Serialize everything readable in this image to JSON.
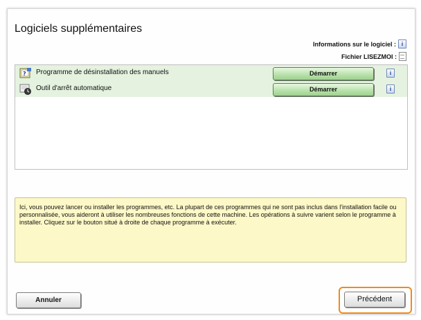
{
  "window": {
    "title": "Logiciels supplémentaires",
    "info_software_label": "Informations sur le logiciel :",
    "readme_label": "Fichier LISEZMOI :",
    "info_icon_glyph": "i"
  },
  "programs": [
    {
      "label": "Programme de désinstallation des manuels",
      "button": "Démarrer",
      "icon": "uninstaller-icon"
    },
    {
      "label": "Outil d'arrêt automatique",
      "button": "Démarrer",
      "icon": "auto-shutdown-icon"
    }
  ],
  "note": {
    "text": "Ici, vous pouvez lancer ou installer les programmes, etc. La plupart de ces programmes qui ne sont pas inclus dans l'installation facile ou personnalisée, vous aideront à utiliser les nombreuses fonctions de cette machine. Les opérations à suivre varient selon le programme à installer. Cliquez sur le bouton situé à droite de chaque programme à exécuter."
  },
  "footer": {
    "cancel_label": "Annuler",
    "previous_label": "Précédent"
  },
  "colors": {
    "highlight": "#f08a1c",
    "row_bg": "#e4f2df",
    "note_bg": "#fdf8c7"
  }
}
